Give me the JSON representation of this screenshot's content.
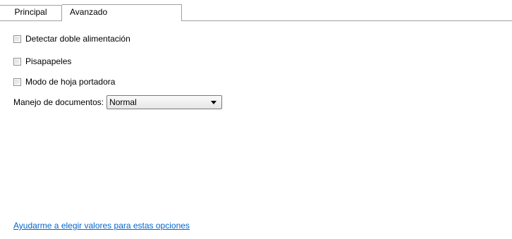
{
  "tabs": [
    {
      "label": "Principal",
      "selected": false
    },
    {
      "label": "Avanzado",
      "selected": true
    }
  ],
  "options": {
    "double_feed": {
      "label": "Detectar doble alimentación",
      "checked": false
    },
    "clipboard": {
      "label": "Pisapapeles",
      "checked": false
    },
    "carrier_sheet": {
      "label": "Modo de hoja portadora",
      "checked": false
    }
  },
  "document_handling": {
    "label": "Manejo de documentos:",
    "selected_value": "Normal"
  },
  "help_link": {
    "label": "Ayudarme a elegir valores para estas opciones"
  },
  "colors": {
    "link": "#0066cc",
    "border": "#a0a0a0"
  }
}
